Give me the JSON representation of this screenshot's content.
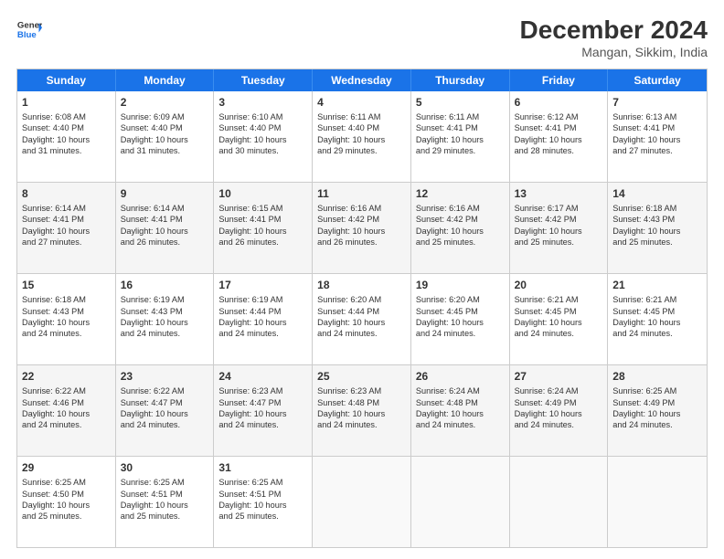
{
  "header": {
    "logo_line1": "General",
    "logo_line2": "Blue",
    "month": "December 2024",
    "location": "Mangan, Sikkim, India"
  },
  "days_of_week": [
    "Sunday",
    "Monday",
    "Tuesday",
    "Wednesday",
    "Thursday",
    "Friday",
    "Saturday"
  ],
  "weeks": [
    {
      "alt": false,
      "cells": [
        {
          "day": "1",
          "lines": [
            "Sunrise: 6:08 AM",
            "Sunset: 4:40 PM",
            "Daylight: 10 hours",
            "and 31 minutes."
          ]
        },
        {
          "day": "2",
          "lines": [
            "Sunrise: 6:09 AM",
            "Sunset: 4:40 PM",
            "Daylight: 10 hours",
            "and 31 minutes."
          ]
        },
        {
          "day": "3",
          "lines": [
            "Sunrise: 6:10 AM",
            "Sunset: 4:40 PM",
            "Daylight: 10 hours",
            "and 30 minutes."
          ]
        },
        {
          "day": "4",
          "lines": [
            "Sunrise: 6:11 AM",
            "Sunset: 4:40 PM",
            "Daylight: 10 hours",
            "and 29 minutes."
          ]
        },
        {
          "day": "5",
          "lines": [
            "Sunrise: 6:11 AM",
            "Sunset: 4:41 PM",
            "Daylight: 10 hours",
            "and 29 minutes."
          ]
        },
        {
          "day": "6",
          "lines": [
            "Sunrise: 6:12 AM",
            "Sunset: 4:41 PM",
            "Daylight: 10 hours",
            "and 28 minutes."
          ]
        },
        {
          "day": "7",
          "lines": [
            "Sunrise: 6:13 AM",
            "Sunset: 4:41 PM",
            "Daylight: 10 hours",
            "and 27 minutes."
          ]
        }
      ]
    },
    {
      "alt": true,
      "cells": [
        {
          "day": "8",
          "lines": [
            "Sunrise: 6:14 AM",
            "Sunset: 4:41 PM",
            "Daylight: 10 hours",
            "and 27 minutes."
          ]
        },
        {
          "day": "9",
          "lines": [
            "Sunrise: 6:14 AM",
            "Sunset: 4:41 PM",
            "Daylight: 10 hours",
            "and 26 minutes."
          ]
        },
        {
          "day": "10",
          "lines": [
            "Sunrise: 6:15 AM",
            "Sunset: 4:41 PM",
            "Daylight: 10 hours",
            "and 26 minutes."
          ]
        },
        {
          "day": "11",
          "lines": [
            "Sunrise: 6:16 AM",
            "Sunset: 4:42 PM",
            "Daylight: 10 hours",
            "and 26 minutes."
          ]
        },
        {
          "day": "12",
          "lines": [
            "Sunrise: 6:16 AM",
            "Sunset: 4:42 PM",
            "Daylight: 10 hours",
            "and 25 minutes."
          ]
        },
        {
          "day": "13",
          "lines": [
            "Sunrise: 6:17 AM",
            "Sunset: 4:42 PM",
            "Daylight: 10 hours",
            "and 25 minutes."
          ]
        },
        {
          "day": "14",
          "lines": [
            "Sunrise: 6:18 AM",
            "Sunset: 4:43 PM",
            "Daylight: 10 hours",
            "and 25 minutes."
          ]
        }
      ]
    },
    {
      "alt": false,
      "cells": [
        {
          "day": "15",
          "lines": [
            "Sunrise: 6:18 AM",
            "Sunset: 4:43 PM",
            "Daylight: 10 hours",
            "and 24 minutes."
          ]
        },
        {
          "day": "16",
          "lines": [
            "Sunrise: 6:19 AM",
            "Sunset: 4:43 PM",
            "Daylight: 10 hours",
            "and 24 minutes."
          ]
        },
        {
          "day": "17",
          "lines": [
            "Sunrise: 6:19 AM",
            "Sunset: 4:44 PM",
            "Daylight: 10 hours",
            "and 24 minutes."
          ]
        },
        {
          "day": "18",
          "lines": [
            "Sunrise: 6:20 AM",
            "Sunset: 4:44 PM",
            "Daylight: 10 hours",
            "and 24 minutes."
          ]
        },
        {
          "day": "19",
          "lines": [
            "Sunrise: 6:20 AM",
            "Sunset: 4:45 PM",
            "Daylight: 10 hours",
            "and 24 minutes."
          ]
        },
        {
          "day": "20",
          "lines": [
            "Sunrise: 6:21 AM",
            "Sunset: 4:45 PM",
            "Daylight: 10 hours",
            "and 24 minutes."
          ]
        },
        {
          "day": "21",
          "lines": [
            "Sunrise: 6:21 AM",
            "Sunset: 4:45 PM",
            "Daylight: 10 hours",
            "and 24 minutes."
          ]
        }
      ]
    },
    {
      "alt": true,
      "cells": [
        {
          "day": "22",
          "lines": [
            "Sunrise: 6:22 AM",
            "Sunset: 4:46 PM",
            "Daylight: 10 hours",
            "and 24 minutes."
          ]
        },
        {
          "day": "23",
          "lines": [
            "Sunrise: 6:22 AM",
            "Sunset: 4:47 PM",
            "Daylight: 10 hours",
            "and 24 minutes."
          ]
        },
        {
          "day": "24",
          "lines": [
            "Sunrise: 6:23 AM",
            "Sunset: 4:47 PM",
            "Daylight: 10 hours",
            "and 24 minutes."
          ]
        },
        {
          "day": "25",
          "lines": [
            "Sunrise: 6:23 AM",
            "Sunset: 4:48 PM",
            "Daylight: 10 hours",
            "and 24 minutes."
          ]
        },
        {
          "day": "26",
          "lines": [
            "Sunrise: 6:24 AM",
            "Sunset: 4:48 PM",
            "Daylight: 10 hours",
            "and 24 minutes."
          ]
        },
        {
          "day": "27",
          "lines": [
            "Sunrise: 6:24 AM",
            "Sunset: 4:49 PM",
            "Daylight: 10 hours",
            "and 24 minutes."
          ]
        },
        {
          "day": "28",
          "lines": [
            "Sunrise: 6:25 AM",
            "Sunset: 4:49 PM",
            "Daylight: 10 hours",
            "and 24 minutes."
          ]
        }
      ]
    },
    {
      "alt": false,
      "cells": [
        {
          "day": "29",
          "lines": [
            "Sunrise: 6:25 AM",
            "Sunset: 4:50 PM",
            "Daylight: 10 hours",
            "and 25 minutes."
          ]
        },
        {
          "day": "30",
          "lines": [
            "Sunrise: 6:25 AM",
            "Sunset: 4:51 PM",
            "Daylight: 10 hours",
            "and 25 minutes."
          ]
        },
        {
          "day": "31",
          "lines": [
            "Sunrise: 6:25 AM",
            "Sunset: 4:51 PM",
            "Daylight: 10 hours",
            "and 25 minutes."
          ]
        },
        {
          "day": "",
          "lines": []
        },
        {
          "day": "",
          "lines": []
        },
        {
          "day": "",
          "lines": []
        },
        {
          "day": "",
          "lines": []
        }
      ]
    }
  ]
}
